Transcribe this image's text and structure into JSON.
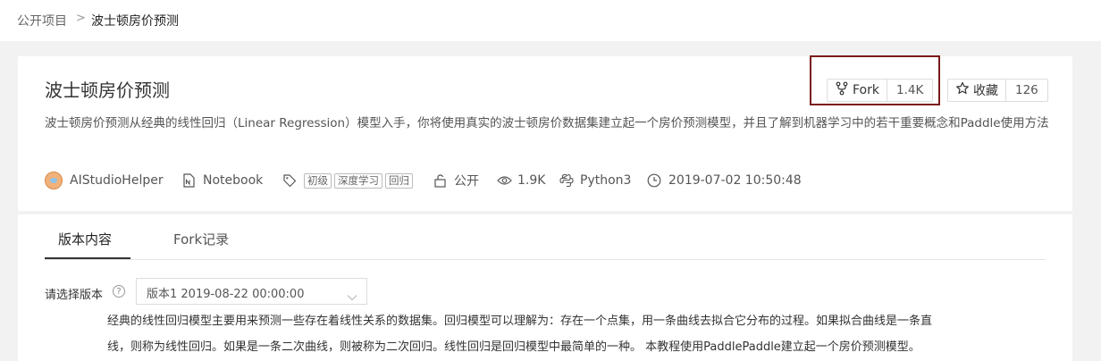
{
  "breadcrumb": {
    "root": "公开项目",
    "separator": ">",
    "current": "波士顿房价预测"
  },
  "project": {
    "title": "波士顿房价预测",
    "description": "波士顿房价预测从经典的线性回归（Linear Regression）模型入手，你将使用真实的波士顿房价数据集建立起一个房价预测模型，并且了解到机器学习中的若干重要概念和Paddle使用方法",
    "author": "AIStudioHelper",
    "type": "Notebook",
    "tags": [
      "初级",
      "深度学习",
      "回归"
    ],
    "visibility": "公开",
    "views": "1.9K",
    "language": "Python3",
    "created": "2019-07-02 10:50:48"
  },
  "actions": {
    "fork_label": "Fork",
    "fork_count": "1.4K",
    "star_label": "收藏",
    "star_count": "126"
  },
  "tabs": [
    {
      "label": "版本内容",
      "active": true
    },
    {
      "label": "Fork记录",
      "active": false
    }
  ],
  "version": {
    "label": "请选择版本",
    "help": "?",
    "selected": "版本1 2019-08-22 00:00:00"
  },
  "content": {
    "line1": "经典的线性回归模型主要用来预测一些存在着线性关系的数据集。回归模型可以理解为：存在一个点集，用一条曲线去拟合它分布的过程。如果拟合曲线是一条直",
    "line2": "线，则称为线性回归。如果是一条二次曲线，则被称为二次回归。线性回归是回归模型中最简单的一种。 本教程使用PaddlePaddle建立起一个房价预测模型。"
  },
  "colors": {
    "highlight_box": "#7b1a1a",
    "page_bg": "#f2f2f2"
  }
}
